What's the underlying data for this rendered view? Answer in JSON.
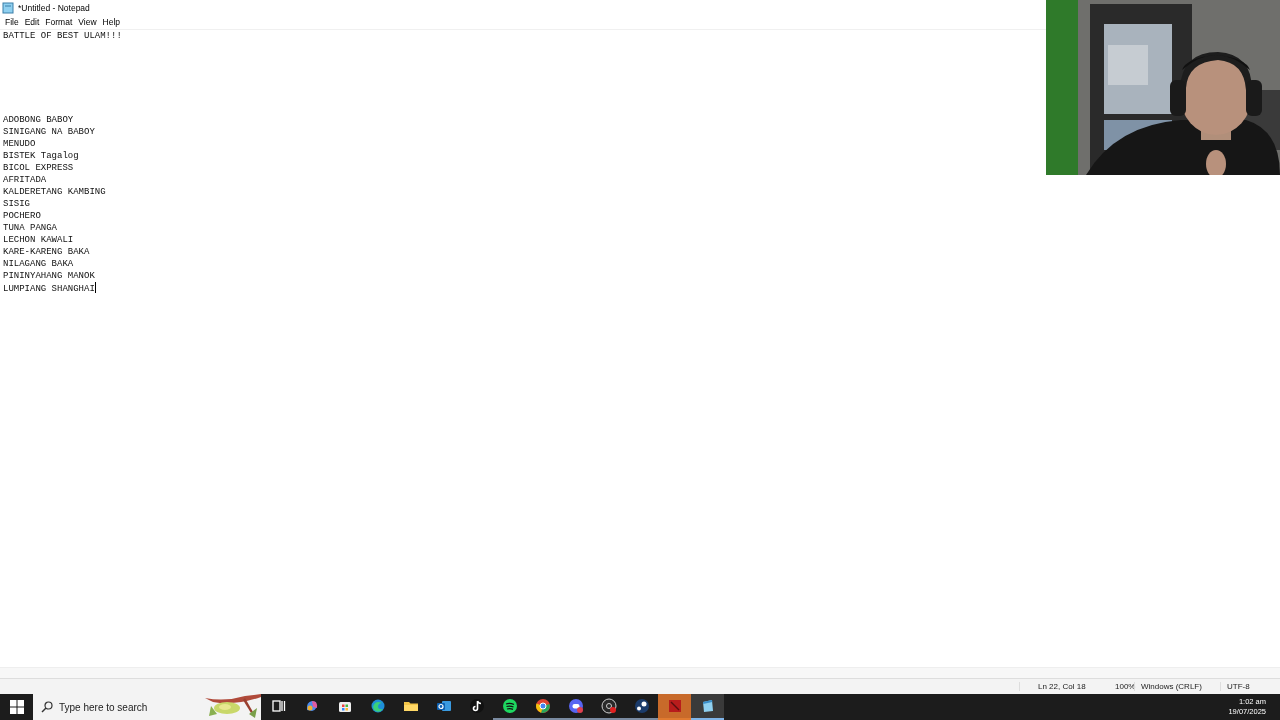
{
  "window": {
    "title": "*Untitled - Notepad"
  },
  "menu": [
    "File",
    "Edit",
    "Format",
    "View",
    "Help"
  ],
  "editor": {
    "text": "BATTLE OF BEST ULAM!!!\n\n\n\n\n\n\nADOBONG BABOY\nSINIGANG NA BABOY\nMENUDO\nBISTEK Tagalog\nBICOL EXPRESS\nAFRITADA\nKALDERETANG KAMBING\nSISIG\nPOCHERO\nTUNA PANGA\nLECHON KAWALI\nKARE-KARENG BAKA\nNILAGANG BAKA\nPININYAHANG MANOK\nLUMPIANG SHANGHAI"
  },
  "status_bar": {
    "position": "Ln 22, Col 18",
    "zoom": "100%",
    "line_ending": "Windows (CRLF)",
    "encoding": "UTF-8"
  },
  "taskbar": {
    "search": {
      "placeholder": "Type here to search"
    },
    "apps": [
      {
        "kind": "taskview",
        "running": false,
        "selected": false,
        "flashing": false
      },
      {
        "kind": "copilot",
        "running": false,
        "selected": false,
        "flashing": false
      },
      {
        "kind": "store",
        "running": false,
        "selected": false,
        "flashing": false
      },
      {
        "kind": "edge",
        "running": false,
        "selected": false,
        "flashing": false
      },
      {
        "kind": "folder",
        "running": false,
        "selected": false,
        "flashing": false
      },
      {
        "kind": "mail",
        "running": false,
        "selected": false,
        "flashing": false
      },
      {
        "kind": "note",
        "running": false,
        "selected": false,
        "flashing": false
      },
      {
        "kind": "music",
        "running": true,
        "selected": false,
        "flashing": false
      },
      {
        "kind": "browser",
        "running": true,
        "selected": false,
        "flashing": false
      },
      {
        "kind": "chat",
        "running": true,
        "selected": false,
        "flashing": false
      },
      {
        "kind": "record",
        "running": true,
        "selected": false,
        "flashing": false
      },
      {
        "kind": "game",
        "running": true,
        "selected": false,
        "flashing": false
      },
      {
        "kind": "red",
        "running": true,
        "selected": false,
        "flashing": true
      },
      {
        "kind": "notepad",
        "running": true,
        "selected": true,
        "flashing": false
      }
    ],
    "time": "1:02 am",
    "date": "19/07/2025"
  }
}
